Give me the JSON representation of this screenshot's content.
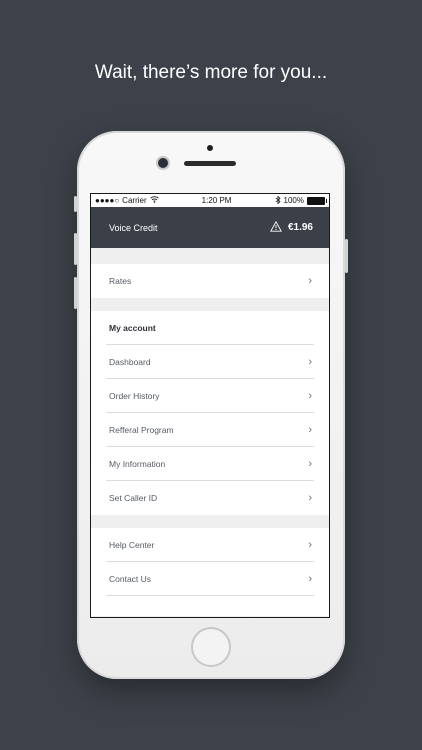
{
  "headline": "Wait, there’s more for you...",
  "status_bar": {
    "carrier": "Carrier",
    "time": "1:20 PM",
    "battery": "100%"
  },
  "header": {
    "title": "Voice Credit",
    "credit": "€1.96",
    "icon": "warning-icon"
  },
  "rates": {
    "label": "Rates"
  },
  "account": {
    "title": "My account",
    "items": [
      {
        "label": "Dashboard"
      },
      {
        "label": "Order History"
      },
      {
        "label": "Refferal Program"
      },
      {
        "label": "My Information"
      },
      {
        "label": "Set Caller ID"
      }
    ]
  },
  "support": {
    "items": [
      {
        "label": "Help Center"
      },
      {
        "label": "Contact Us"
      }
    ]
  },
  "colors": {
    "background": "#3d424a",
    "header": "#3b4048"
  }
}
